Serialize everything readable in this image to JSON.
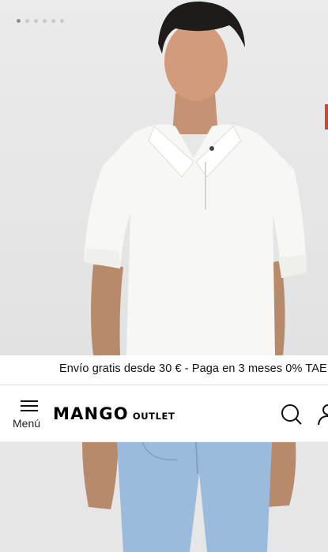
{
  "carousel": {
    "total_slides": 6,
    "active_slide": 1
  },
  "promo_bar": {
    "text": "Envío gratis desde 30 € - Paga en 3 meses 0% TAE"
  },
  "header": {
    "menu_label": "Menú",
    "logo_main": "MANGO",
    "logo_sub": "OUTLET",
    "search_icon": "search-icon",
    "user_icon": "user-icon"
  },
  "product_image": {
    "subject": "model wearing white short-sleeve polo shirt and light blue jeans"
  },
  "colors": {
    "accent": "#d6452a",
    "text": "#111111",
    "background": "#ffffff"
  }
}
